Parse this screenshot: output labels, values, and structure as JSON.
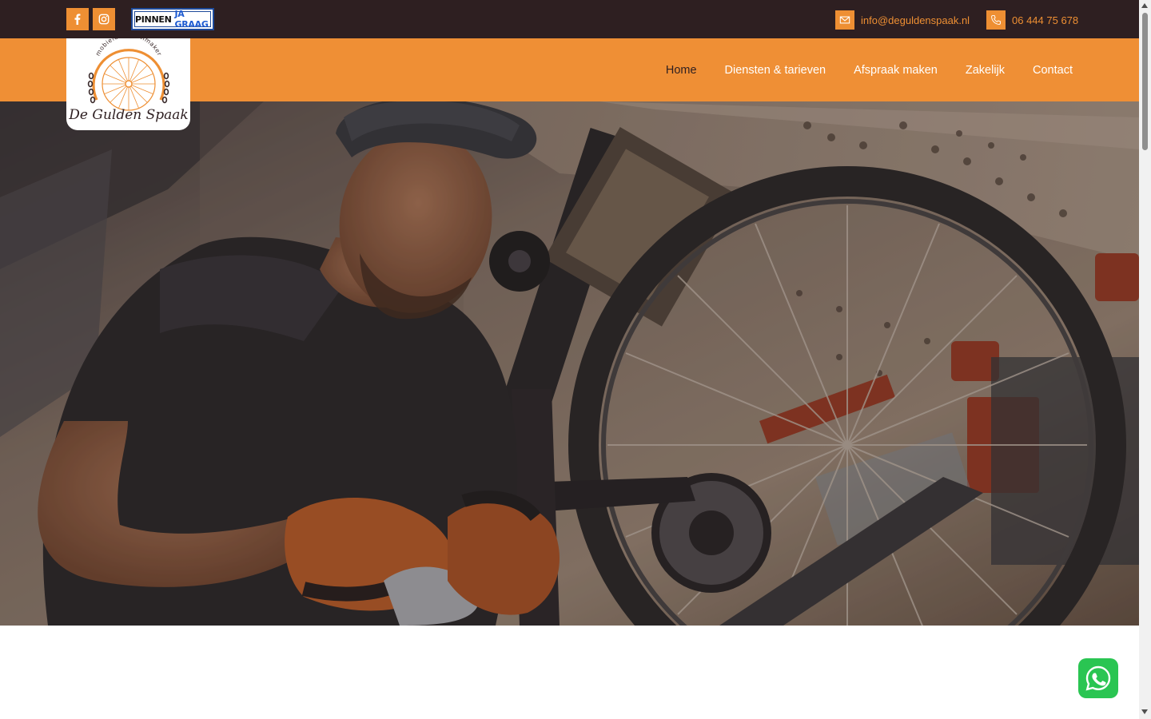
{
  "topbar": {
    "socials": [
      {
        "name": "facebook",
        "icon": "facebook-icon"
      },
      {
        "name": "instagram",
        "icon": "instagram-icon"
      }
    ],
    "badge": {
      "part1": "PINNEN",
      "part2": "JA GRAAG"
    },
    "email": "info@deguldenspaak.nl",
    "phone": "06 444 75 678"
  },
  "logo": {
    "tagline": "mobiele fietsenmaker",
    "name": "De Gulden Spaak"
  },
  "nav": {
    "items": [
      {
        "label": "Home"
      },
      {
        "label": "Diensten & tarieven"
      },
      {
        "label": "Afspraak maken"
      },
      {
        "label": "Zakelijk"
      },
      {
        "label": "Contact"
      }
    ]
  },
  "hero": {
    "image_alt": "Fietsenmaker aan het werk aan een mountainbike in een bus"
  },
  "colors": {
    "brand_orange": "#ef8f35",
    "topbar_dark": "#2e1f21",
    "whatsapp_green": "#2ac552",
    "badge_blue": "#1e4a9a"
  }
}
